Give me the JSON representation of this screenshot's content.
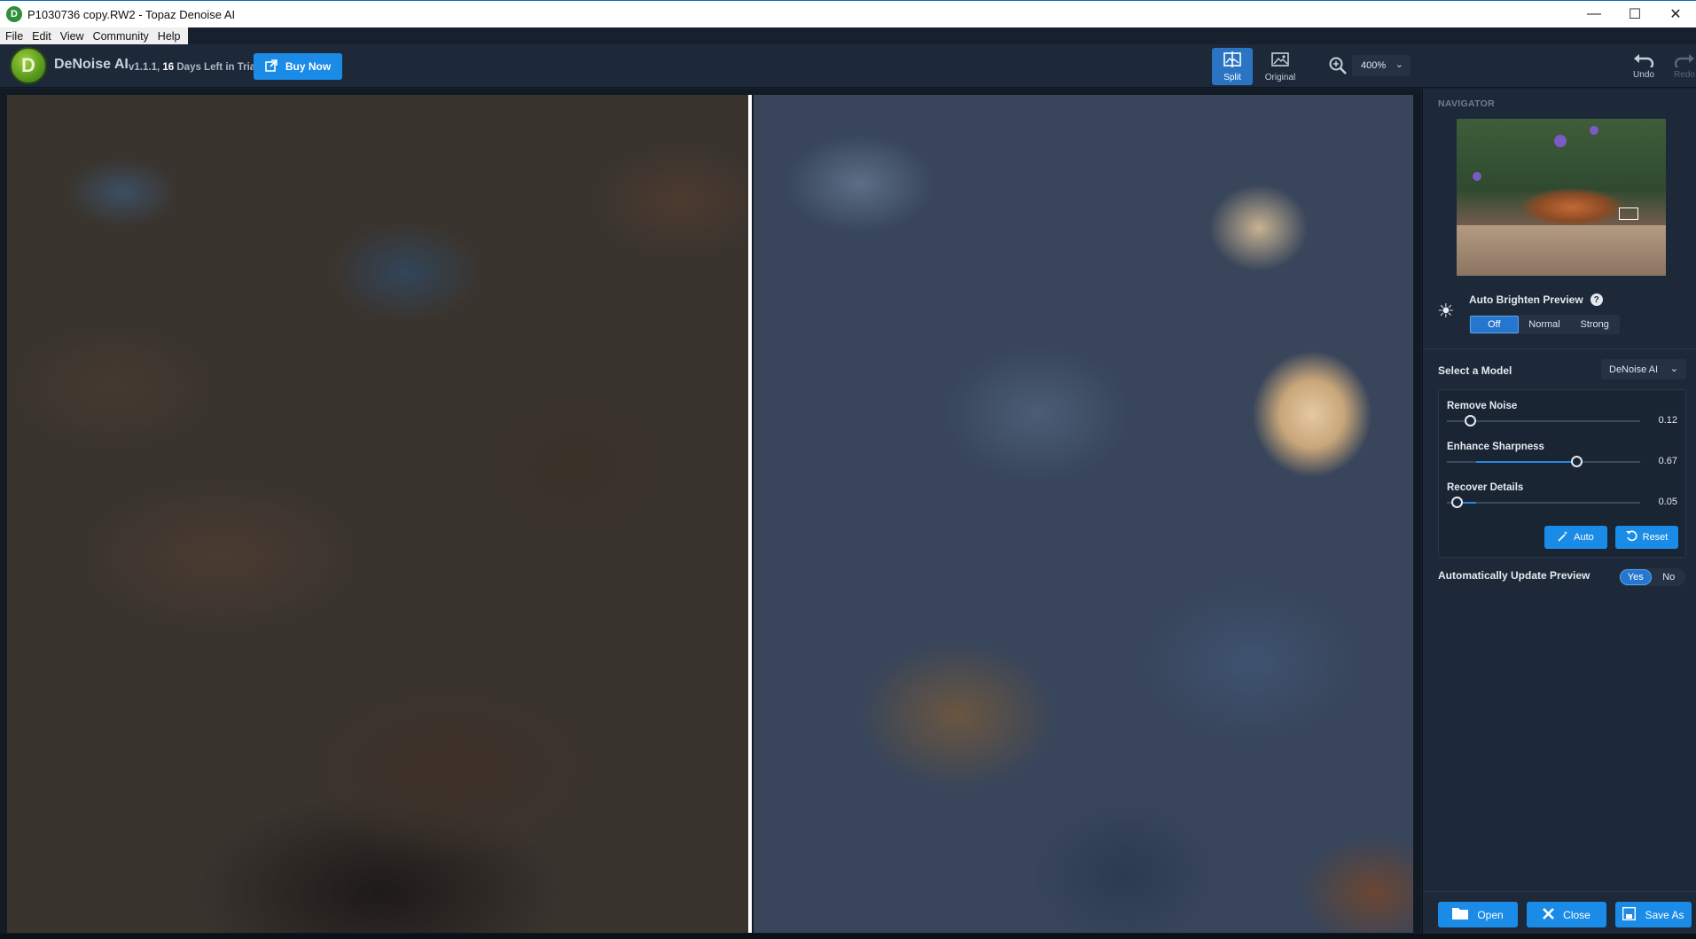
{
  "window": {
    "title": "P1030736 copy.RW2 - Topaz Denoise AI",
    "controls": [
      "minimize-icon",
      "maximize-icon",
      "close-icon"
    ]
  },
  "menu": {
    "items": [
      "File",
      "Edit",
      "View",
      "Community",
      "Help"
    ]
  },
  "toolbar": {
    "logo_letter": "D",
    "app_name": "DeNoise AI",
    "version_prefix": "v1.1.1, ",
    "days_left": "16",
    "trial_suffix": " Days Left in Trial",
    "buy_label": "Buy Now",
    "view_split_label": "Split",
    "view_original_label": "Original",
    "active_view": "Split",
    "zoom_value": "400%",
    "undo_label": "Undo",
    "redo_label": "Redo"
  },
  "navigator": {
    "label": "NAVIGATOR"
  },
  "brighten": {
    "label": "Auto Brighten Preview",
    "help": "?",
    "options": [
      "Off",
      "Normal",
      "Strong"
    ],
    "selected": "Off"
  },
  "model": {
    "label": "Select a Model",
    "value": "DeNoise AI"
  },
  "sliders": [
    {
      "label": "Remove Noise",
      "value": 0.12,
      "display": "0.12"
    },
    {
      "label": "Enhance Sharpness",
      "value": 0.67,
      "display": "0.67"
    },
    {
      "label": "Recover Details",
      "value": 0.05,
      "display": "0.05"
    }
  ],
  "actions": {
    "auto_label": "Auto",
    "reset_label": "Reset"
  },
  "auto_update": {
    "label": "Automatically Update Preview",
    "options": [
      "Yes",
      "No"
    ],
    "selected": "Yes"
  },
  "bottom": {
    "open_label": "Open",
    "close_label": "Close",
    "save_label": "Save As"
  },
  "colors": {
    "accent": "#1a8be6",
    "panel_bg": "#1d2939",
    "toolbar_bg": "#1d2939"
  }
}
